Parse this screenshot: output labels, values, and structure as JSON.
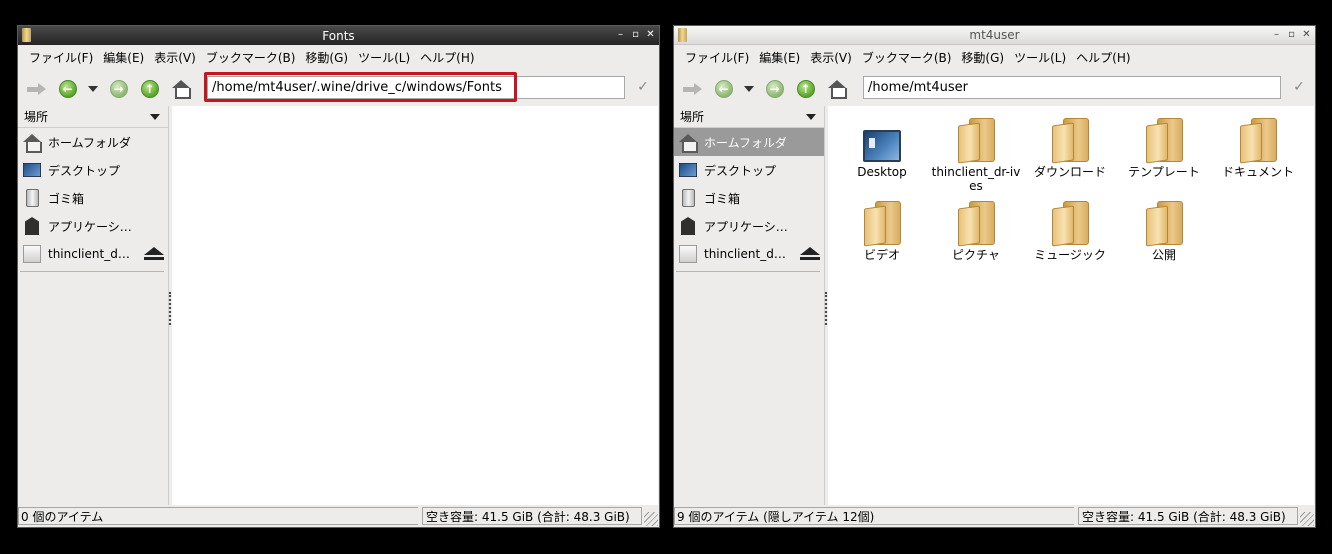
{
  "left_window": {
    "title": "Fonts",
    "menu": [
      "ファイル(F)",
      "編集(E)",
      "表示(V)",
      "ブックマーク(B)",
      "移動(G)",
      "ツール(L)",
      "ヘルプ(H)"
    ],
    "path": "/home/mt4user/.wine/drive_c/windows/Fonts",
    "places_label": "場所",
    "places": [
      {
        "label": "ホームフォルダ",
        "icon": "home-icon"
      },
      {
        "label": "デスクトップ",
        "icon": "desktop-icon"
      },
      {
        "label": "ゴミ箱",
        "icon": "trash-icon"
      },
      {
        "label": "アプリケーシ…",
        "icon": "applications-icon"
      },
      {
        "label": "thinclient_d…",
        "icon": "drive-icon"
      }
    ],
    "status_left": "0 個のアイテム",
    "status_right": "空き容量: 41.5 GiB (合計: 48.3 GiB)"
  },
  "right_window": {
    "title": "mt4user",
    "menu": [
      "ファイル(F)",
      "編集(E)",
      "表示(V)",
      "ブックマーク(B)",
      "移動(G)",
      "ツール(L)",
      "ヘルプ(H)"
    ],
    "path": "/home/mt4user",
    "places_label": "場所",
    "places": [
      {
        "label": "ホームフォルダ",
        "icon": "home-icon"
      },
      {
        "label": "デスクトップ",
        "icon": "desktop-icon"
      },
      {
        "label": "ゴミ箱",
        "icon": "trash-icon"
      },
      {
        "label": "アプリケーシ…",
        "icon": "applications-icon"
      },
      {
        "label": "thinclient_d…",
        "icon": "drive-icon"
      }
    ],
    "files": [
      {
        "label": "Desktop",
        "icon": "desktop-folder-icon"
      },
      {
        "label": "thinclient_dr-ives",
        "icon": "folder-icon"
      },
      {
        "label": "ダウンロード",
        "icon": "folder-icon"
      },
      {
        "label": "テンプレート",
        "icon": "folder-icon"
      },
      {
        "label": "ドキュメント",
        "icon": "folder-icon"
      },
      {
        "label": "ビデオ",
        "icon": "folder-icon"
      },
      {
        "label": "ピクチャ",
        "icon": "folder-icon"
      },
      {
        "label": "ミュージック",
        "icon": "folder-icon"
      },
      {
        "label": "公開",
        "icon": "folder-icon"
      }
    ],
    "status_left": "9 個のアイテム (隠しアイテム 12個)",
    "status_right": "空き容量: 41.5 GiB (合計: 48.3 GiB)"
  }
}
